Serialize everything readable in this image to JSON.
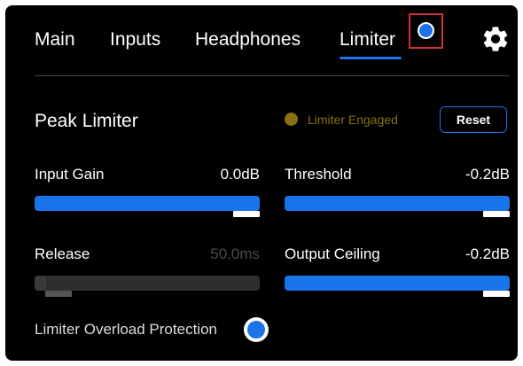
{
  "tabs": [
    {
      "label": "Main",
      "active": false
    },
    {
      "label": "Inputs",
      "active": false
    },
    {
      "label": "Headphones",
      "active": false
    },
    {
      "label": "Limiter",
      "active": true
    }
  ],
  "icons": {
    "power": "power-toggle-icon",
    "settings": "gear-icon"
  },
  "colors": {
    "accent": "#1a73e8",
    "engaged_indicator": "#8a6f14",
    "highlight_box": "#d32f2f"
  },
  "limiter": {
    "title": "Peak Limiter",
    "status": "Limiter Engaged",
    "reset_label": "Reset",
    "input_gain": {
      "label": "Input Gain",
      "value": "0.0dB",
      "level": 1.0
    },
    "threshold": {
      "label": "Threshold",
      "value": "-0.2dB",
      "level": 1.0
    },
    "release": {
      "label": "Release",
      "value": "50.0ms",
      "level": 0.05,
      "enabled": false
    },
    "output_ceiling": {
      "label": "Output Ceiling",
      "value": "-0.2dB",
      "level": 1.0
    },
    "overload_protection": {
      "label": "Limiter Overload Protection",
      "enabled": true
    }
  }
}
